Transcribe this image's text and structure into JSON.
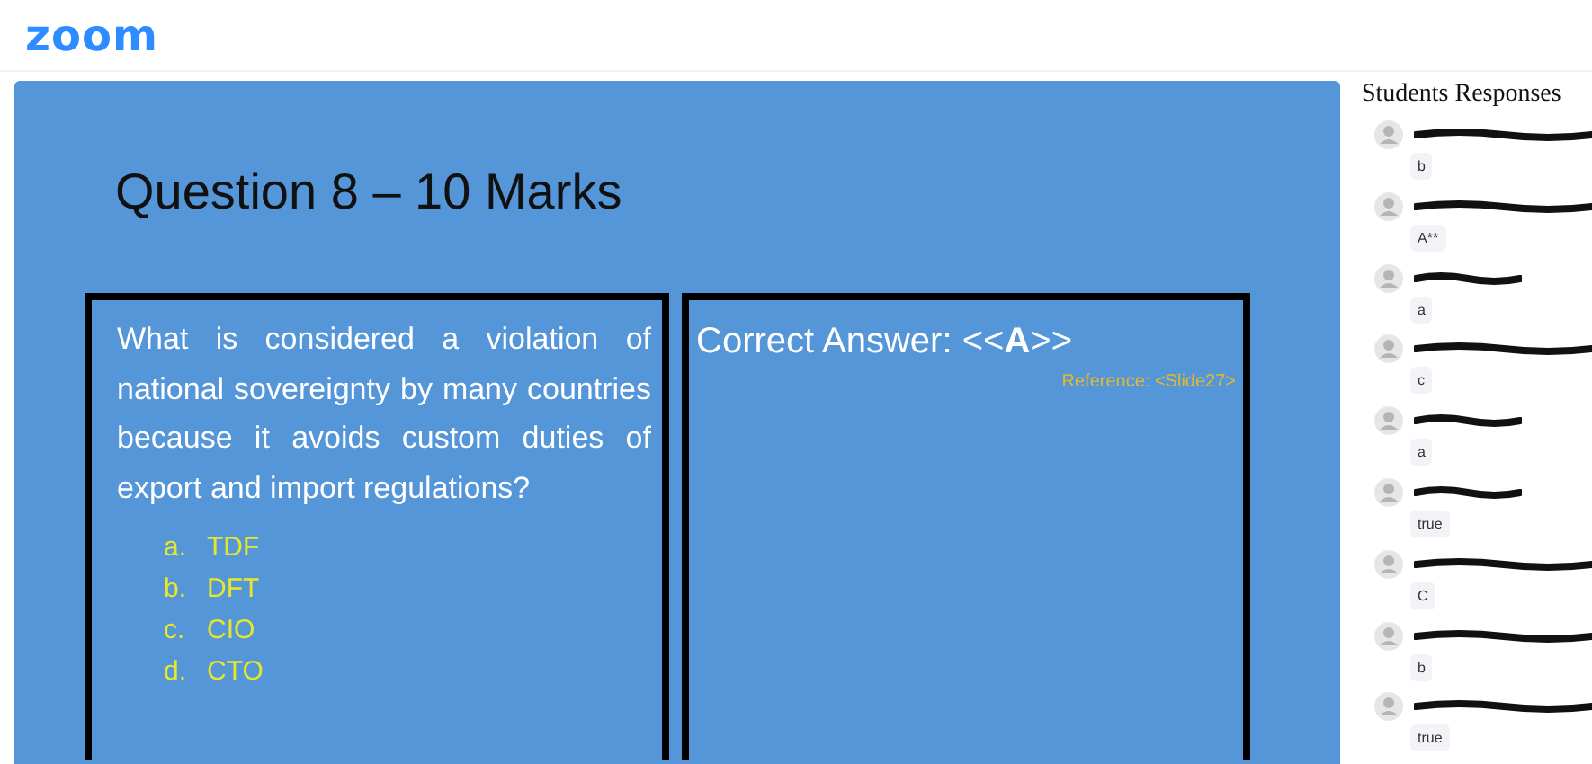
{
  "logo": "zoom",
  "slide": {
    "title": "Question 8 – 10 Marks",
    "question": "What is considered a violation of national sovereignty by many countries because it avoids custom duties of export and import regulations?",
    "options": [
      {
        "letter": "a.",
        "text": "TDF"
      },
      {
        "letter": "b.",
        "text": "DFT"
      },
      {
        "letter": "c.",
        "text": "CIO"
      },
      {
        "letter": "d.",
        "text": "CTO"
      }
    ],
    "answer": "Correct Answer: <<**A**>>",
    "reference": "Reference: <Slide27>"
  },
  "responses_panel": {
    "title": "Students Responses",
    "responses": [
      {
        "kind": "long",
        "answer": "b"
      },
      {
        "kind": "long",
        "answer": "A**"
      },
      {
        "kind": "short",
        "answer": "a"
      },
      {
        "kind": "long",
        "answer": "c"
      },
      {
        "kind": "short",
        "answer": "a"
      },
      {
        "kind": "short",
        "answer": "true"
      },
      {
        "kind": "long",
        "answer": "C"
      },
      {
        "kind": "long",
        "answer": "b"
      },
      {
        "kind": "long",
        "answer": "true"
      }
    ]
  }
}
